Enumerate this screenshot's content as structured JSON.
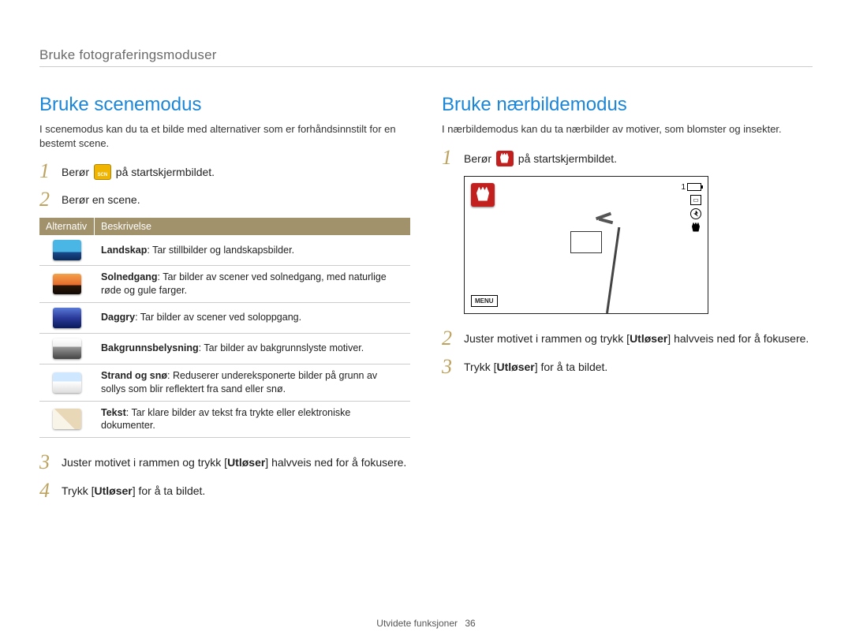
{
  "page_header": "Bruke fotograferingsmoduser",
  "footer": {
    "section": "Utvidete funksjoner",
    "page_number": "36"
  },
  "left": {
    "heading": "Bruke scenemodus",
    "intro": "I scenemodus kan du ta et bilde med alternativer som er forhåndsinnstilt for en bestemt scene.",
    "step1_pre": "Berør ",
    "step1_post": " på startskjermbildet.",
    "step2": "Berør en scene.",
    "table_header_alt": "Alternativ",
    "table_header_desc": "Beskrivelse",
    "rows": [
      {
        "title": "Landskap",
        "desc": ": Tar stillbilder og landskapsbilder."
      },
      {
        "title": "Solnedgang",
        "desc": ": Tar bilder av scener ved solnedgang, med naturlige røde og gule farger."
      },
      {
        "title": "Daggry",
        "desc": ": Tar bilder av scener ved soloppgang."
      },
      {
        "title": "Bakgrunnsbelysning",
        "desc": ": Tar bilder av bakgrunnslyste motiver."
      },
      {
        "title": "Strand og snø",
        "desc": ": Reduserer undereksponerte bilder på grunn av sollys som blir reflektert fra sand eller snø."
      },
      {
        "title": "Tekst",
        "desc": ": Tar klare bilder av tekst fra trykte eller elektroniske dokumenter."
      }
    ],
    "step3_pre": "Juster motivet i rammen og trykk [",
    "step3_bold": "Utløser",
    "step3_post": "] halvveis ned for å fokusere.",
    "step4_pre": "Trykk [",
    "step4_bold": "Utløser",
    "step4_post": "] for å ta bildet."
  },
  "right": {
    "heading": "Bruke nærbildemodus",
    "intro": "I nærbildemodus kan du ta nærbilder av motiver, som blomster og insekter.",
    "step1_pre": "Berør ",
    "step1_post": " på startskjermbildet.",
    "preview": {
      "count": "1",
      "menu_label": "MENU"
    },
    "step2_pre": "Juster motivet i rammen og trykk [",
    "step2_bold": "Utløser",
    "step2_post": "] halvveis ned for å fokusere.",
    "step3_pre": "Trykk [",
    "step3_bold": "Utløser",
    "step3_post": "] for å ta bildet."
  },
  "numbers": {
    "n1": "1",
    "n2": "2",
    "n3": "3",
    "n4": "4"
  }
}
